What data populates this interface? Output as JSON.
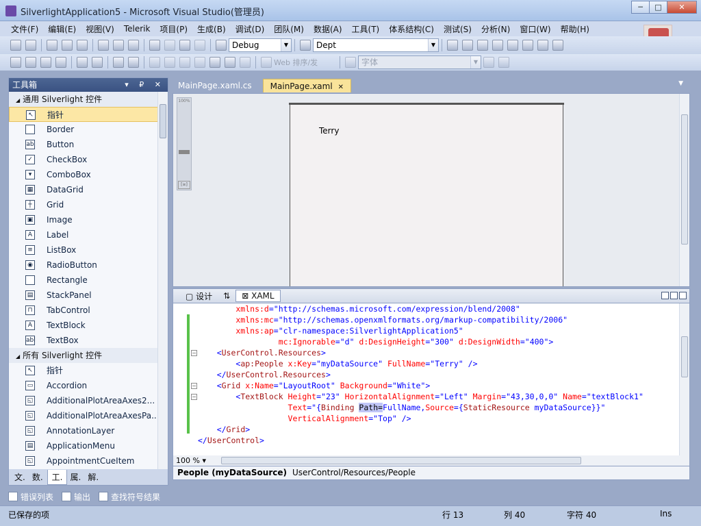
{
  "window": {
    "title": "SilverlightApplication5 - Microsoft Visual Studio(管理员)",
    "min_label": "─",
    "max_label": "□",
    "close_label": "✕"
  },
  "menu": [
    "文件(F)",
    "编辑(E)",
    "视图(V)",
    "Telerik",
    "项目(P)",
    "生成(B)",
    "调试(D)",
    "团队(M)",
    "数据(A)",
    "工具(T)",
    "体系结构(C)",
    "测试(S)",
    "分析(N)",
    "窗口(W)",
    "帮助(H)"
  ],
  "toolbar": {
    "config": "Debug",
    "find_target": "Dept",
    "disabled_label": "Web 排序/发",
    "disabled_combo": "字体"
  },
  "toolbox": {
    "title": "工具箱",
    "header_buttons": "▾ ₽ ✕",
    "group1": "通用 Silverlight 控件",
    "group1_items": [
      {
        "label": "指针",
        "icon": "pointer-icon",
        "glyph": "↖"
      },
      {
        "label": "Border",
        "icon": "border-icon",
        "glyph": ""
      },
      {
        "label": "Button",
        "icon": "button-icon",
        "glyph": "ab"
      },
      {
        "label": "CheckBox",
        "icon": "checkbox-icon",
        "glyph": "✓"
      },
      {
        "label": "ComboBox",
        "icon": "combobox-icon",
        "glyph": "▾"
      },
      {
        "label": "DataGrid",
        "icon": "datagrid-icon",
        "glyph": "▦"
      },
      {
        "label": "Grid",
        "icon": "grid-icon",
        "glyph": "┼"
      },
      {
        "label": "Image",
        "icon": "image-icon",
        "glyph": "▣"
      },
      {
        "label": "Label",
        "icon": "label-icon",
        "glyph": "A"
      },
      {
        "label": "ListBox",
        "icon": "listbox-icon",
        "glyph": "≡"
      },
      {
        "label": "RadioButton",
        "icon": "radiobutton-icon",
        "glyph": "◉"
      },
      {
        "label": "Rectangle",
        "icon": "rectangle-icon",
        "glyph": ""
      },
      {
        "label": "StackPanel",
        "icon": "stackpanel-icon",
        "glyph": "▤"
      },
      {
        "label": "TabControl",
        "icon": "tabcontrol-icon",
        "glyph": "⊓"
      },
      {
        "label": "TextBlock",
        "icon": "textblock-icon",
        "glyph": "A"
      },
      {
        "label": "TextBox",
        "icon": "textbox-icon",
        "glyph": "abl"
      }
    ],
    "group2": "所有 Silverlight 控件",
    "group2_items": [
      {
        "label": "指针",
        "icon": "pointer-icon",
        "glyph": "↖"
      },
      {
        "label": "Accordion",
        "icon": "accordion-icon",
        "glyph": "▭"
      },
      {
        "label": "AdditionalPlotAreaAxes2...",
        "icon": "plotarea-icon",
        "glyph": "◱"
      },
      {
        "label": "AdditionalPlotAreaAxesPa...",
        "icon": "plotarea-icon",
        "glyph": "◱"
      },
      {
        "label": "AnnotationLayer",
        "icon": "annotation-icon",
        "glyph": "◱"
      },
      {
        "label": "ApplicationMenu",
        "icon": "appmenu-icon",
        "glyph": "▤"
      },
      {
        "label": "AppointmentCueItem",
        "icon": "appointment-icon",
        "glyph": "◱"
      }
    ],
    "tabs": [
      "文.",
      "数.",
      "工.",
      "属.",
      "解."
    ]
  },
  "doc_tabs": [
    {
      "label": "MainPage.xaml.cs"
    },
    {
      "label": "MainPage.xaml",
      "close": "✕"
    }
  ],
  "designer": {
    "zoom_top": "100%",
    "fit_label": "[≥]",
    "textblock_text": "Terry"
  },
  "split": {
    "design_tab": "设计",
    "swap": "⇅",
    "xaml_tab": "XAML"
  },
  "code_lines": [
    [
      {
        "c": "a",
        "t": "        xmlns:d"
      },
      {
        "c": "v",
        "t": "=\"http://schemas.microsoft.com/expression/blend/2008\""
      }
    ],
    [
      {
        "c": "a",
        "t": "        xmlns:mc"
      },
      {
        "c": "v",
        "t": "=\"http://schemas.openxmlformats.org/markup-compatibility/2006\""
      }
    ],
    [
      {
        "c": "a",
        "t": "        xmlns:ap"
      },
      {
        "c": "v",
        "t": "=\"clr-namespace:SilverlightApplication5\""
      }
    ],
    [
      {
        "c": "a",
        "t": "                 mc:Ignorable"
      },
      {
        "c": "v",
        "t": "=\"d\" "
      },
      {
        "c": "a",
        "t": "d:DesignHeight"
      },
      {
        "c": "v",
        "t": "=\"300\" "
      },
      {
        "c": "a",
        "t": "d:DesignWidth"
      },
      {
        "c": "v",
        "t": "=\"400\""
      },
      {
        "c": "p",
        "t": ">"
      }
    ],
    [
      {
        "c": "p",
        "t": "    <"
      },
      {
        "c": "t",
        "t": "UserControl.Resources"
      },
      {
        "c": "p",
        "t": ">"
      }
    ],
    [
      {
        "c": "p",
        "t": "        <"
      },
      {
        "c": "t",
        "t": "ap:People"
      },
      {
        "c": "a",
        "t": " x:Key"
      },
      {
        "c": "v",
        "t": "=\"myDataSource\" "
      },
      {
        "c": "a",
        "t": "FullName"
      },
      {
        "c": "v",
        "t": "=\"Terry\" "
      },
      {
        "c": "p",
        "t": "/>"
      }
    ],
    [
      {
        "c": "p",
        "t": "    </"
      },
      {
        "c": "t",
        "t": "UserControl.Resources"
      },
      {
        "c": "p",
        "t": ">"
      }
    ],
    [
      {
        "c": "p",
        "t": "    <"
      },
      {
        "c": "t",
        "t": "Grid"
      },
      {
        "c": "a",
        "t": " x:Name"
      },
      {
        "c": "v",
        "t": "=\"LayoutRoot\" "
      },
      {
        "c": "a",
        "t": "Background"
      },
      {
        "c": "v",
        "t": "=\"White\""
      },
      {
        "c": "p",
        "t": ">"
      }
    ],
    [
      {
        "c": "p",
        "t": "        <"
      },
      {
        "c": "t",
        "t": "TextBlock"
      },
      {
        "c": "a",
        "t": " Height"
      },
      {
        "c": "v",
        "t": "=\"23\" "
      },
      {
        "c": "a",
        "t": "HorizontalAlignment"
      },
      {
        "c": "v",
        "t": "=\"Left\" "
      },
      {
        "c": "a",
        "t": "Margin"
      },
      {
        "c": "v",
        "t": "=\"43,30,0,0\" "
      },
      {
        "c": "a",
        "t": "Name"
      },
      {
        "c": "v",
        "t": "=\"textBlock1\""
      }
    ],
    [
      {
        "c": "a",
        "t": "                   Text"
      },
      {
        "c": "v",
        "t": "=\"{"
      },
      {
        "c": "t",
        "t": "Binding "
      },
      {
        "c": "hl",
        "t": "Path="
      },
      {
        "c": "v",
        "t": "FullName,"
      },
      {
        "c": "a",
        "t": "Source"
      },
      {
        "c": "v",
        "t": "={"
      },
      {
        "c": "t",
        "t": "StaticResource "
      },
      {
        "c": "v",
        "t": "myDataSource}}\""
      }
    ],
    [
      {
        "c": "a",
        "t": "                   VerticalAlignment"
      },
      {
        "c": "v",
        "t": "=\"Top\" "
      },
      {
        "c": "p",
        "t": "/>"
      }
    ],
    [
      {
        "c": "p",
        "t": "    </"
      },
      {
        "c": "t",
        "t": "Grid"
      },
      {
        "c": "p",
        "t": ">"
      }
    ],
    [
      {
        "c": "p",
        "t": "</"
      },
      {
        "c": "t",
        "t": "UserControl"
      },
      {
        "c": "p",
        "t": ">"
      }
    ]
  ],
  "editor": {
    "zoom": "100 %",
    "zoom_dd": "▾"
  },
  "breadcrumb": {
    "first": "People (myDataSource)",
    "path": "UserControl/Resources/People"
  },
  "bottom_tabs": [
    "错误列表",
    "输出",
    "查找符号结果"
  ],
  "status": {
    "message": "已保存的项",
    "line": "行 13",
    "col": "列 40",
    "char": "字符 40",
    "mode": "Ins"
  },
  "colors": {
    "chrome_dark": "#3a5282",
    "active_tab": "#f9e39a",
    "change_marker": "#59c24a"
  }
}
